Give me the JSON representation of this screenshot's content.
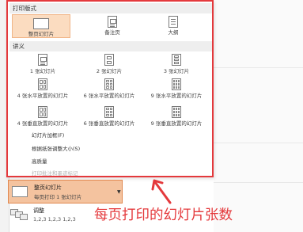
{
  "dropdown": {
    "section_print_layout": "打印版式",
    "layouts": [
      {
        "label": "整页幻灯片",
        "icon": "full-page-slide-icon",
        "selected": true
      },
      {
        "label": "备注页",
        "icon": "notes-page-icon"
      },
      {
        "label": "大纲",
        "icon": "outline-icon"
      }
    ],
    "section_handouts": "讲义",
    "handouts": [
      {
        "label": "1 张幻灯片",
        "icon": "one-slide-icon"
      },
      {
        "label": "2 张幻灯片",
        "icon": "two-slides-icon"
      },
      {
        "label": "3 张幻灯片",
        "icon": "three-slides-icon"
      },
      {
        "label": "4 张水平放置的幻灯片",
        "icon": "four-horizontal-icon"
      },
      {
        "label": "6 张水平放置的幻灯片",
        "icon": "six-horizontal-icon"
      },
      {
        "label": "9 张水平放置的幻灯片",
        "icon": "nine-horizontal-icon"
      },
      {
        "label": "4 张垂直放置的幻灯片",
        "icon": "four-vertical-icon"
      },
      {
        "label": "6 张垂直放置的幻灯片",
        "icon": "six-vertical-icon"
      },
      {
        "label": "9 张垂直放置的幻灯片",
        "icon": "nine-vertical-icon"
      }
    ],
    "options": [
      {
        "label": "幻灯片加框(F)",
        "disabled": false
      },
      {
        "label": "根据纸张调整大小(S)",
        "disabled": false
      },
      {
        "label": "高质量",
        "disabled": false
      },
      {
        "label": "打印批注和墨迹标记",
        "disabled": true
      }
    ]
  },
  "current_layout": {
    "title": "整页幻灯片",
    "subtitle": "每页打印 1 张幻灯片"
  },
  "collate": {
    "title": "调整",
    "subtitle": "1,2,3    1,2,3    1,2,3"
  },
  "annotation": {
    "text": "每页打印的幻灯片张数",
    "color": "#e4393c"
  }
}
